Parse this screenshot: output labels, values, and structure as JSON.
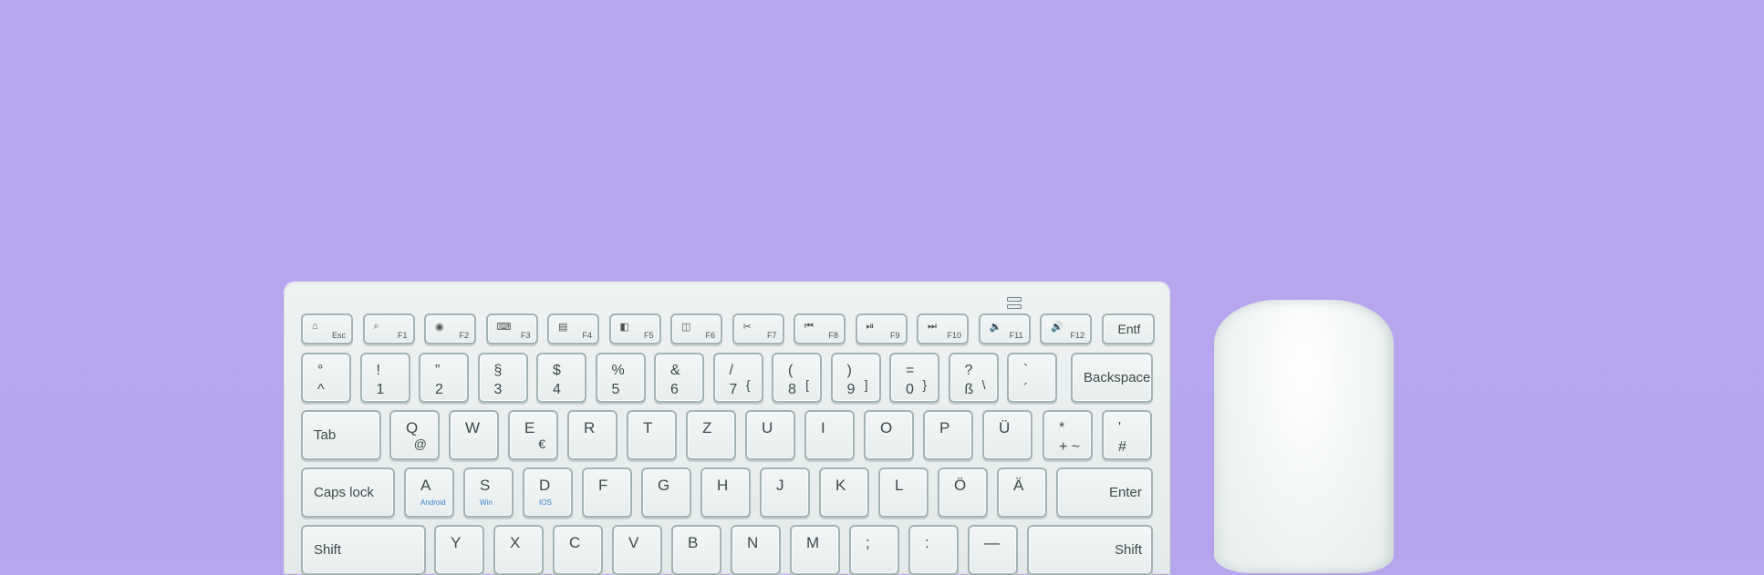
{
  "fn_row": [
    {
      "icon": "⌂",
      "label": "Esc"
    },
    {
      "icon": "⌕",
      "label": "F1"
    },
    {
      "icon": "◉",
      "label": "F2"
    },
    {
      "icon": "⌨",
      "label": "F3"
    },
    {
      "icon": "▤",
      "label": "F4"
    },
    {
      "icon": "◧",
      "label": "F5"
    },
    {
      "icon": "◫",
      "label": "F6"
    },
    {
      "icon": "✂",
      "label": "F7"
    },
    {
      "icon": "⏮",
      "label": "F8"
    },
    {
      "icon": "⏯",
      "label": "F9"
    },
    {
      "icon": "⏭",
      "label": "F10"
    },
    {
      "icon": "🔉",
      "label": "F11"
    },
    {
      "icon": "🔊",
      "label": "F12"
    },
    {
      "icon": "",
      "label": "Entf"
    }
  ],
  "number_row": [
    {
      "top": "°",
      "bottom": "^"
    },
    {
      "top": "!",
      "bottom": "1"
    },
    {
      "top": "”",
      "bottom": "2"
    },
    {
      "top": "§",
      "bottom": "3"
    },
    {
      "top": "$",
      "bottom": "4"
    },
    {
      "top": "%",
      "bottom": "5"
    },
    {
      "top": "&",
      "bottom": "6",
      "alt": ""
    },
    {
      "top": "/",
      "bottom": "7",
      "alt": "{"
    },
    {
      "top": "(",
      "bottom": "8",
      "alt": "["
    },
    {
      "top": ")",
      "bottom": "9",
      "alt": "]"
    },
    {
      "top": "=",
      "bottom": "0",
      "alt": "}"
    },
    {
      "top": "?",
      "bottom": "ß",
      "alt": "\\"
    },
    {
      "top": "`",
      "bottom": "´"
    }
  ],
  "backspace": "Backspace",
  "row_q": {
    "tab": "Tab",
    "keys": [
      "Q",
      "W",
      "E",
      "R",
      "T",
      "Z",
      "U",
      "I",
      "O",
      "P",
      "Ü"
    ],
    "alts": {
      "Q": "@",
      "E": "€"
    },
    "plus": {
      "top": "*",
      "bottom": "+  ~"
    },
    "hash": {
      "top": "'",
      "bottom": "#"
    }
  },
  "row_a": {
    "caps": "Caps lock",
    "keys": [
      "A",
      "S",
      "D",
      "F",
      "G",
      "H",
      "J",
      "K",
      "L",
      "Ö",
      "Ä"
    ],
    "subs": {
      "A": "Android",
      "S": "Win",
      "D": "IOS"
    },
    "enter": "Enter"
  },
  "row_y": {
    "shift_left": "Shift",
    "keys": [
      "Y",
      "X",
      "C",
      "V",
      "B",
      "N",
      "M",
      ";",
      ":",
      "—"
    ],
    "shift_right": "Shift"
  }
}
